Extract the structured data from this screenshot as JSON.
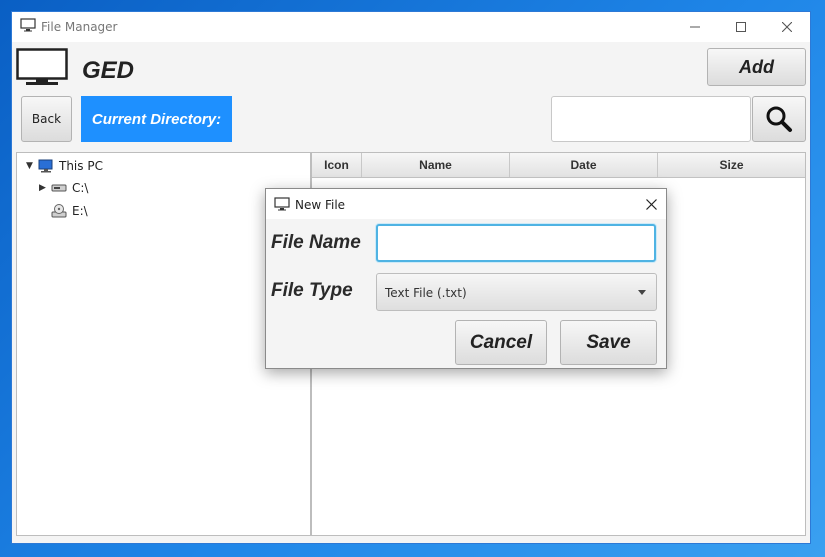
{
  "window": {
    "title": "File Manager"
  },
  "app": {
    "name": "GED"
  },
  "toolbar": {
    "add_label": "Add",
    "back_label": "Back",
    "current_directory_label": "Current Directory:",
    "search_value": ""
  },
  "tree": {
    "items": [
      {
        "label": "This PC",
        "icon": "computer-icon",
        "expanded": true
      },
      {
        "label": "C:\\",
        "icon": "hard-drive-icon",
        "collapsed": true
      },
      {
        "label": "E:\\",
        "icon": "optical-drive-icon"
      }
    ]
  },
  "table": {
    "columns": [
      "Icon",
      "Name",
      "Date",
      "Size"
    ],
    "rows": []
  },
  "dialog": {
    "title": "New File",
    "file_name_label": "File Name",
    "file_name_value": "",
    "file_type_label": "File Type",
    "file_type_value": "Text File (.txt)",
    "cancel_label": "Cancel",
    "save_label": "Save"
  },
  "colors": {
    "accent": "#1e90ff",
    "focus": "#4fb3e3",
    "desktop": "#1f86e8"
  }
}
